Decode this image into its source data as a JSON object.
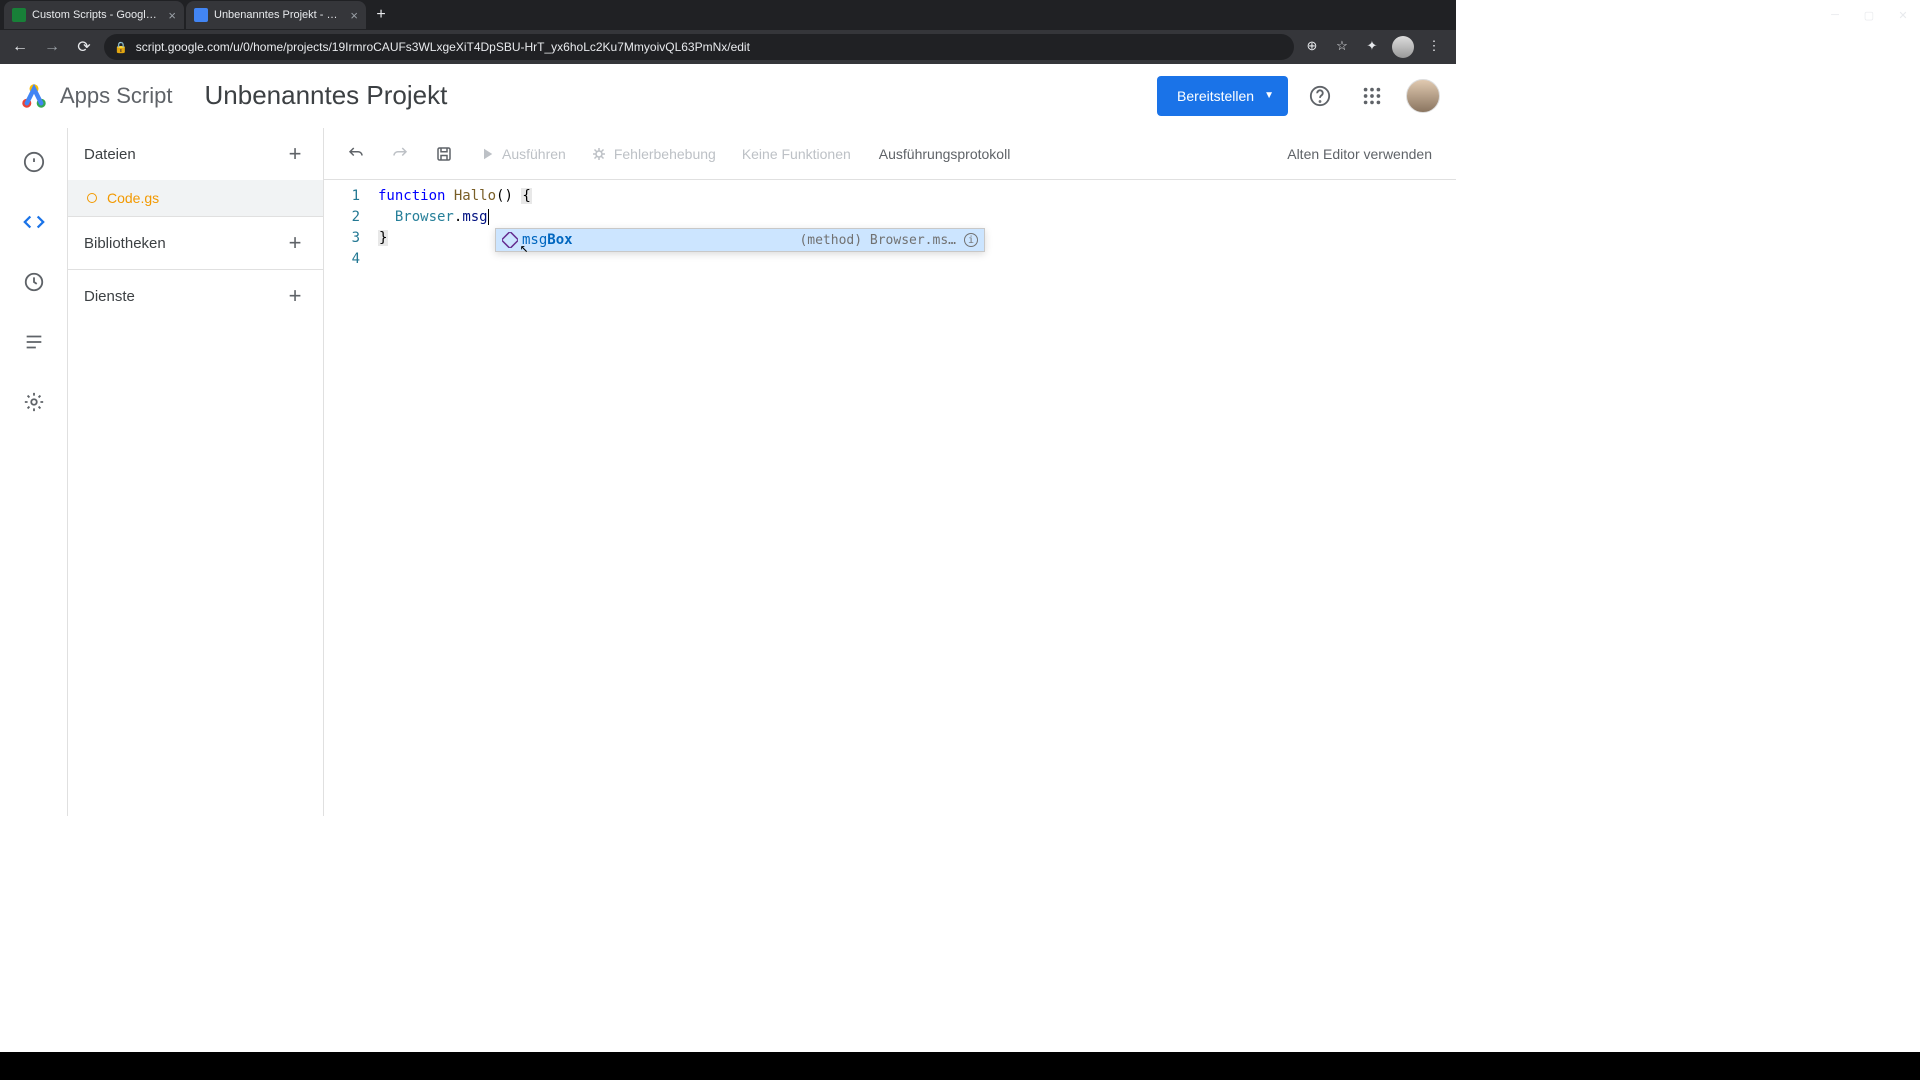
{
  "browser": {
    "tabs": [
      {
        "title": "Custom Scripts - Google Tabellen",
        "favicon": "sheets"
      },
      {
        "title": "Unbenanntes Projekt - Projekt-E",
        "favicon": "script"
      }
    ],
    "url": "script.google.com/u/0/home/projects/19IrmroCAUFs3WLxgeXiT4DpSBU-HrT_yx6hoLc2Ku7MmyoivQL63PmNx/edit"
  },
  "app": {
    "name": "Apps Script",
    "project_title": "Unbenanntes Projekt",
    "deploy_label": "Bereitstellen"
  },
  "sidebar": {
    "files_label": "Dateien",
    "libraries_label": "Bibliotheken",
    "services_label": "Dienste",
    "files": [
      {
        "name": "Code.gs",
        "modified": true,
        "active": true
      }
    ]
  },
  "toolbar": {
    "run_label": "Ausführen",
    "debug_label": "Fehlerbehebung",
    "function_select": "Keine Funktionen",
    "log_label": "Ausführungsprotokoll",
    "legacy_label": "Alten Editor verwenden"
  },
  "code": {
    "lines": [
      {
        "n": 1,
        "tokens": [
          [
            "kw",
            "function"
          ],
          [
            "",
            " "
          ],
          [
            "fn",
            "Hallo"
          ],
          [
            "",
            "() "
          ],
          [
            "brace",
            "{"
          ]
        ]
      },
      {
        "n": 2,
        "tokens": [
          [
            "",
            "  "
          ],
          [
            "obj",
            "Browser"
          ],
          [
            "",
            "."
          ],
          [
            "prop",
            "msg"
          ]
        ],
        "cursor": true
      },
      {
        "n": 3,
        "tokens": [
          [
            "brace",
            "}"
          ]
        ]
      },
      {
        "n": 4,
        "tokens": []
      }
    ]
  },
  "autocomplete": {
    "match": "msg",
    "rest": "Box",
    "hint": "(method) Browser.ms…",
    "full_item": "msgBox"
  }
}
